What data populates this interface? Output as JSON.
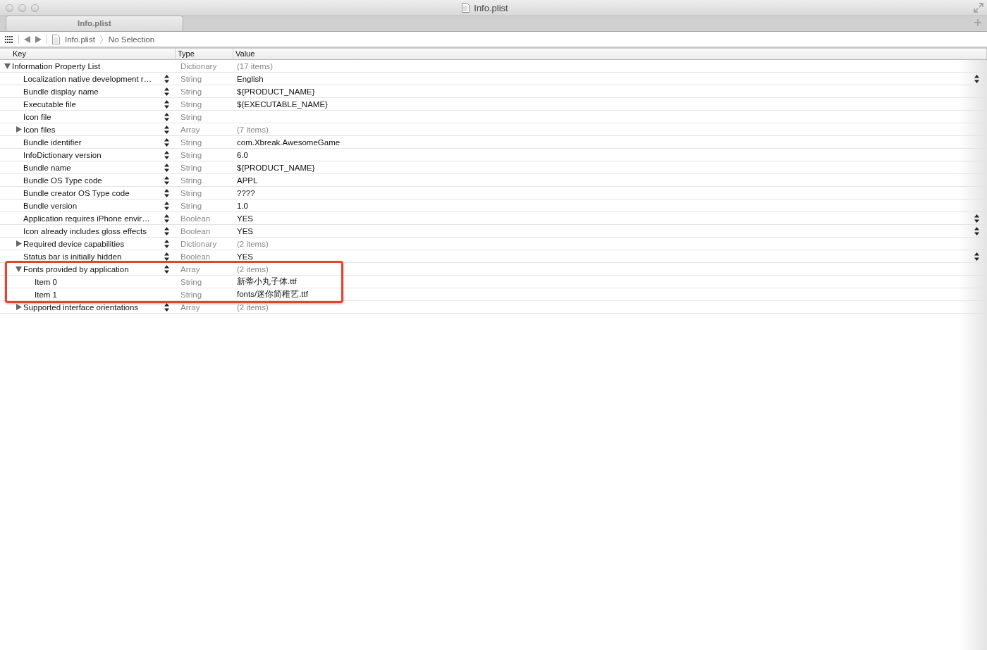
{
  "window": {
    "title": "Info.plist"
  },
  "tabs": [
    {
      "label": "Info.plist",
      "selected": true
    }
  ],
  "jump_bar": {
    "file": "Info.plist",
    "selection": "No Selection"
  },
  "columns": [
    "Key",
    "Type",
    "Value"
  ],
  "tree": {
    "key": "Information Property List",
    "type": "Dictionary",
    "value": "(17 items)",
    "expanded": true,
    "children": [
      {
        "key": "Localization native development r…",
        "type": "String",
        "value": "English",
        "has_value_menu": true
      },
      {
        "key": "Bundle display name",
        "type": "String",
        "value": "${PRODUCT_NAME}",
        "has_value_menu": false
      },
      {
        "key": "Executable file",
        "type": "String",
        "value": "${EXECUTABLE_NAME}",
        "has_value_menu": false
      },
      {
        "key": "Icon file",
        "type": "String",
        "has_value_menu": false
      },
      {
        "key": "Icon files",
        "type": "Array",
        "value": "(7 items)",
        "expanded": false,
        "has_value_menu": false
      },
      {
        "key": "Bundle identifier",
        "type": "String",
        "value": "com.Xbreak.AwesomeGame",
        "has_value_menu": false
      },
      {
        "key": "InfoDictionary version",
        "type": "String",
        "value": "6.0",
        "has_value_menu": false
      },
      {
        "key": "Bundle name",
        "type": "String",
        "value": "${PRODUCT_NAME}",
        "has_value_menu": false
      },
      {
        "key": "Bundle OS Type code",
        "type": "String",
        "value": "APPL",
        "has_value_menu": false
      },
      {
        "key": "Bundle creator OS Type code",
        "type": "String",
        "value": "????",
        "has_value_menu": false
      },
      {
        "key": "Bundle version",
        "type": "String",
        "value": "1.0",
        "has_value_menu": false
      },
      {
        "key": "Application requires iPhone envir…",
        "type": "Boolean",
        "value": "YES",
        "has_value_menu": true
      },
      {
        "key": "Icon already includes gloss effects",
        "type": "Boolean",
        "value": "YES",
        "has_value_menu": true
      },
      {
        "key": "Required device capabilities",
        "type": "Dictionary",
        "value": "(2 items)",
        "expanded": false,
        "has_value_menu": false
      },
      {
        "key": "Status bar is initially hidden",
        "type": "Boolean",
        "value": "YES",
        "has_value_menu": true
      },
      {
        "key": "Fonts provided by application",
        "type": "Array",
        "value": "(2 items)",
        "expanded": true,
        "highlighted": true,
        "has_value_menu": false,
        "children": [
          {
            "key": "Item 0",
            "type": "String",
            "value": "新蒂小丸子体.ttf",
            "has_value_menu": false
          },
          {
            "key": "Item 1",
            "type": "String",
            "value": "fonts/迷你简稚艺.ttf",
            "has_value_menu": false
          }
        ]
      },
      {
        "key": "Supported interface orientations",
        "type": "Array",
        "value": "(2 items)",
        "expanded": false,
        "has_value_menu": false
      }
    ]
  }
}
